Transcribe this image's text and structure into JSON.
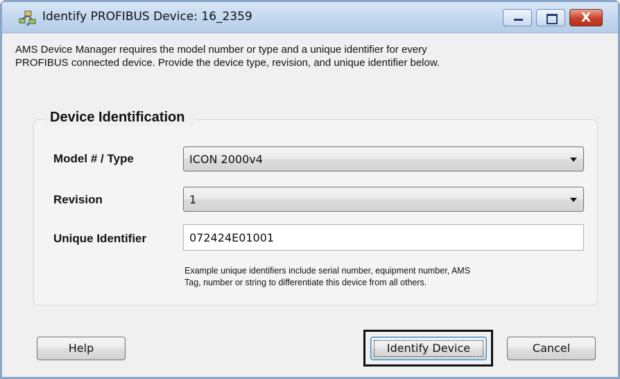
{
  "window": {
    "title": "Identify PROFIBUS Device: 16_2359",
    "controls": {
      "minimize": "minimize",
      "maximize": "maximize",
      "close": "X"
    }
  },
  "intro": {
    "line1": "AMS Device Manager requires the model number or type and a unique identifier for every",
    "line2": "PROFIBUS connected device.  Provide the device type, revision, and unique identifier below."
  },
  "group": {
    "title": "Device Identification",
    "model": {
      "label": "Model # / Type",
      "value": "ICON 2000v4"
    },
    "revision": {
      "label": "Revision",
      "value": "1"
    },
    "unique_id": {
      "label": "Unique Identifier",
      "value": "072424E01001"
    },
    "hint_line1": "Example unique identifiers include serial number, equipment number, AMS",
    "hint_line2": "Tag, number or string to differentiate this device from all others."
  },
  "buttons": {
    "help": "Help",
    "identify": "Identify Device",
    "cancel": "Cancel"
  },
  "colors": {
    "titlebar": "#c4d8ef",
    "close_button": "#c7402a",
    "highlight_box": "#111111"
  },
  "icons": {
    "app": "network-device-icon",
    "dropdown": "chevron-down-icon"
  }
}
